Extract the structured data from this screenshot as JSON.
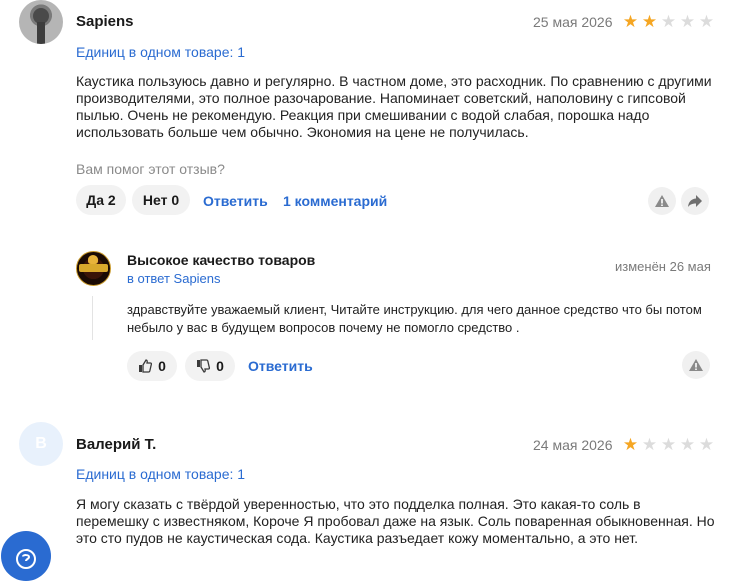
{
  "review1": {
    "author": "Sapiens",
    "date": "25 мая 2026",
    "rating": 2,
    "quantity": "Единиц в одном товаре: 1",
    "text": "Каустика пользуюсь давно и регулярно. В частном доме, это расходник. По сравнению с другими производителями, это полное разочарование. Напоминает советский, наполовину с гипсовой пылью. Очень не рекомендую. Реакция при смешивании с водой слабая, порошка надо использовать больше чем обычно. Экономия на цене не получилась.",
    "helpful_question": "Вам помог этот отзыв?",
    "yes_label": "Да 2",
    "no_label": "Нет 0",
    "reply_label": "Ответить",
    "comments_label": "1 комментарий"
  },
  "reply": {
    "author": "Высокое качество товаров",
    "in_reply_to": "в ответ Sapiens",
    "edited": "изменён 26 мая",
    "text": "здравствуйте уважаемый клиент, Читайте инструкцию. для чего данное средство что бы потом небыло у вас в будущем вопросов почему не помогло средство .",
    "likes": "0",
    "dislikes": "0",
    "reply_label": "Ответить"
  },
  "review2": {
    "avatar_letter": "В",
    "author": "Валерий Т.",
    "date": "24 мая 2026",
    "rating": 1,
    "quantity": "Единиц в одном товаре: 1",
    "text": "Я могу сказать с твёрдой уверенностью, что это подделка полная. Это какая-то соль в перемешку с известняком, Короче Я пробовал даже на язык. Соль поваренная обыкновенная. Но это сто пудов не каустическая сода. Каустика разъедает кожу моментально, а это нет."
  },
  "icons": {
    "report": "warning-triangle-icon",
    "share": "share-arrow-icon",
    "like": "thumbs-up-icon",
    "dislike": "thumbs-down-icon",
    "chat": "chat-help-icon"
  },
  "colors": {
    "accent": "#2a6bd1",
    "star": "#f5a623",
    "star_empty": "#dcdcdc"
  }
}
